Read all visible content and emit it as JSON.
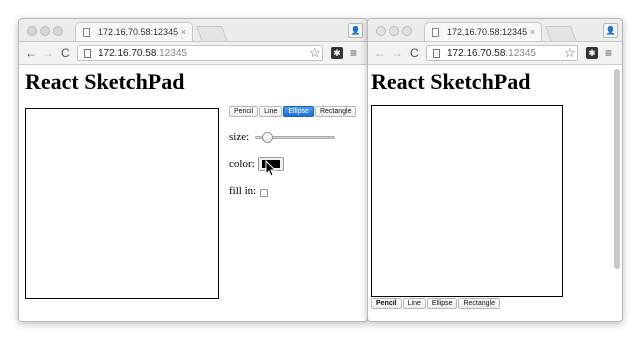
{
  "left_window": {
    "tab_title": "172.16.70.58:12345",
    "url_host": "172.16.70.58",
    "url_port": ":12345",
    "page_heading": "React SketchPad",
    "tools": [
      "Pencil",
      "Line",
      "Ellipse",
      "Rectangle"
    ],
    "active_tool": "Ellipse",
    "size_label": "size:",
    "size_value_fraction": 0.1,
    "color_label": "color:",
    "color_value": "#000000",
    "fill_label": "fill in:",
    "fill_checked": false
  },
  "right_window": {
    "tab_title": "172.16.70.58:12345",
    "url_host": "172.16.70.58",
    "url_port": ":12345",
    "page_heading": "React SketchPad",
    "tools": [
      "Pencil",
      "Line",
      "Ellipse",
      "Rectangle"
    ],
    "active_tool": "Pencil"
  },
  "icons": {
    "back": "←",
    "forward": "→",
    "reload": "C",
    "star": "☆",
    "menu": "≡",
    "close": "×",
    "profile": "👤"
  }
}
